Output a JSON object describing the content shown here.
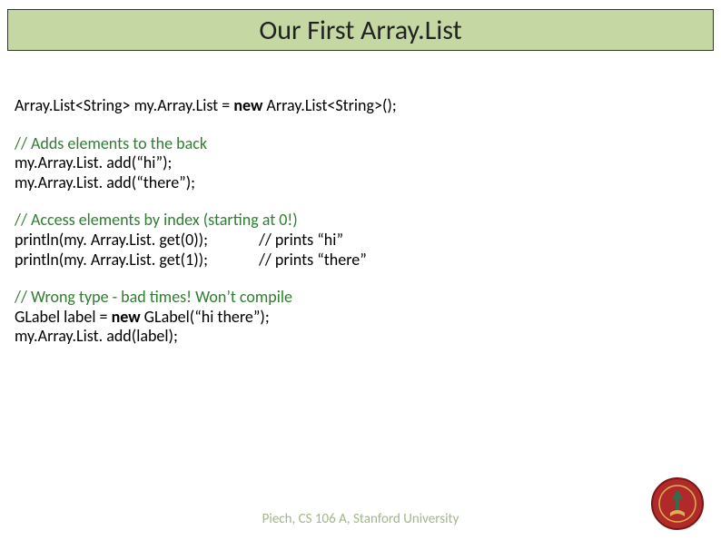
{
  "title": "Our First Array.List",
  "decl": {
    "pre": "Array.List<String> my.Array.List = ",
    "kw": "new",
    "post": " Array.List<String>();"
  },
  "sec1": {
    "comment": "// Adds elements to the back",
    "l1": "my.Array.List. add(“hi”);",
    "l2": "my.Array.List. add(“there”);"
  },
  "sec2": {
    "comment": "// Access elements by index (starting at 0!)",
    "l1a": "println(my. Array.List. get(0));",
    "l1b": "// prints “hi”",
    "l2a": "println(my. Array.List. get(1));",
    "l2b": "// prints “there”"
  },
  "sec3": {
    "comment": "// Wrong type - bad times!  Won’t compile",
    "l1a": "GLabel label = ",
    "l1kw": "new",
    "l1b": " GLabel(“hi there”);",
    "l2": "my.Array.List. add(label);"
  },
  "footer": "Piech, CS 106 A, Stanford University"
}
